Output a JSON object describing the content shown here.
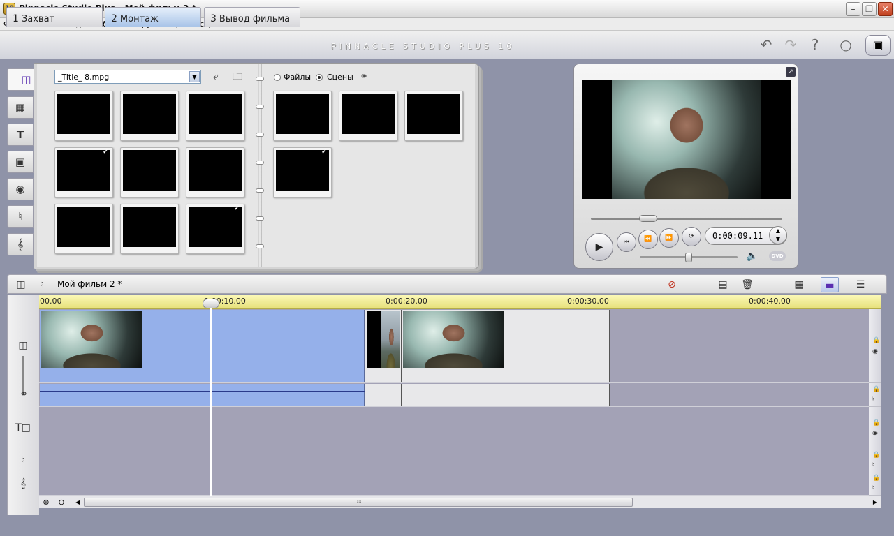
{
  "window": {
    "title": "Pinnacle Studio Plus - Мой фильм 2 *",
    "icon_label": "10",
    "min_icon": "minimize-icon",
    "max_icon": "maximize-icon",
    "close_icon": "close-icon"
  },
  "menu": [
    "Файл",
    "Монтаж",
    "Вид",
    "Альбом",
    "Инструментарий",
    "Настройки",
    "Помощь"
  ],
  "tabs": [
    {
      "num": "1",
      "label": "Захват"
    },
    {
      "num": "2",
      "label": "Монтаж"
    },
    {
      "num": "3",
      "label": "Вывод фильма"
    }
  ],
  "active_tab": 1,
  "brand": "PINNACLE STUDIO PLUS 10",
  "top_icons": [
    "undo-icon",
    "redo-icon",
    "help-icon",
    "hint-bulb-icon",
    "studio-box-icon"
  ],
  "side_tabs": [
    "video-scenes-icon",
    "transitions-icon",
    "titles-icon",
    "still-images-icon",
    "disc-menus-icon",
    "sound-effects-icon",
    "music-icon"
  ],
  "album": {
    "file_select": "_Title_ 8.mpg",
    "radio_files": "Файлы",
    "radio_scenes": "Сцены",
    "selected_radio": "scenes",
    "left_thumbs": [
      {
        "img": "black",
        "checked": false
      },
      {
        "img": "black",
        "checked": false
      },
      {
        "img": "outdoor",
        "checked": false
      },
      {
        "img": "outdoor",
        "checked": true
      },
      {
        "img": "black",
        "checked": false
      },
      {
        "img": "black",
        "checked": false
      },
      {
        "img": "face",
        "checked": false
      },
      {
        "img": "black",
        "checked": false
      },
      {
        "img": "face",
        "checked": true
      }
    ],
    "right_thumbs": [
      {
        "img": "black",
        "checked": false
      },
      {
        "img": "face",
        "checked": false
      },
      {
        "img": "black",
        "checked": false
      },
      {
        "img": "face",
        "checked": true
      }
    ]
  },
  "player": {
    "timecode": "0:00:09.11",
    "dvd": "DVD",
    "scrub_position": 0.3,
    "volume_level": 0.5
  },
  "timeline": {
    "title": "Мой фильм 2 *",
    "ticks": [
      "00.00",
      "0:00:10.00",
      "0:00:20.00",
      "0:00:30.00",
      "0:00:40.00"
    ],
    "scroll_grip": "::::"
  },
  "colors": {
    "accent_selected": "#95b0ea",
    "ruler": "#e6e07a",
    "track_bg": "#a3a2b6"
  }
}
